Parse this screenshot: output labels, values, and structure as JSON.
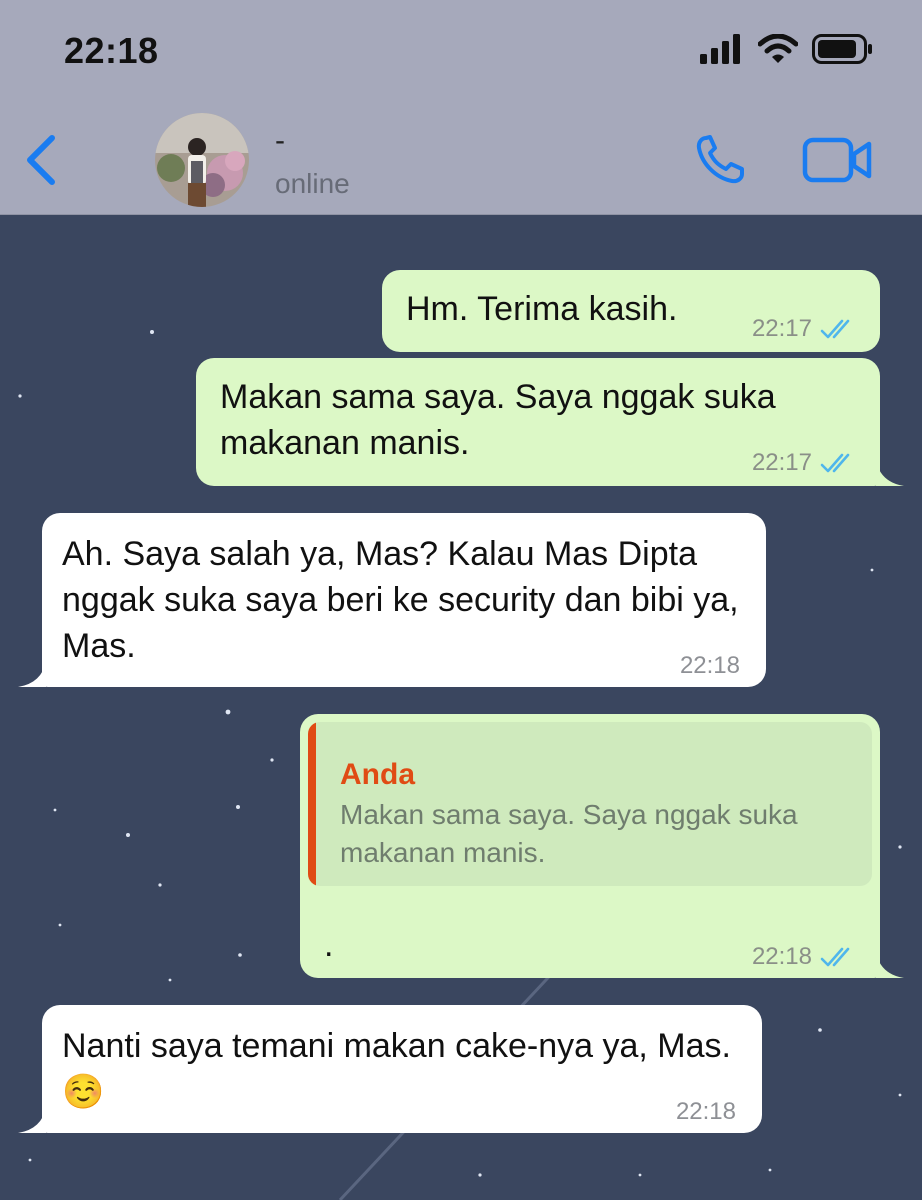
{
  "status_bar": {
    "time": "22:18"
  },
  "header": {
    "contact_name": "-",
    "contact_status": "online"
  },
  "messages": [
    {
      "direction": "out",
      "text": "Hm. Terima kasih.",
      "time": "22:17",
      "read": true
    },
    {
      "direction": "out",
      "text": "Makan sama saya. Saya nggak suka makanan manis.",
      "time": "22:17",
      "read": true
    },
    {
      "direction": "in",
      "text": "Ah. Saya salah ya, Mas? Kalau Mas Dipta nggak suka saya beri ke security dan bibi ya, Mas.",
      "time": "22:18"
    },
    {
      "direction": "out",
      "text": ".",
      "time": "22:18",
      "read": true,
      "reply_to": {
        "author": "Anda",
        "text": "Makan sama saya. Saya nggak suka makanan manis."
      }
    },
    {
      "direction": "in",
      "text": "Nanti saya temani makan cake-nya ya, Mas.☺️",
      "time": "22:18"
    }
  ],
  "colors": {
    "header_bg": "#a6a9bb",
    "accent_blue": "#1a7cf0",
    "outgoing_bubble": "#dcf8c6",
    "incoming_bubble": "#ffffff",
    "chat_background": "#3a465f",
    "reply_author": "#e04b14",
    "read_ticks": "#4fb6ec"
  },
  "icons": [
    "back-chevron-icon",
    "voice-call-icon",
    "video-call-icon",
    "signal-icon",
    "wifi-icon",
    "battery-icon",
    "read-receipt-icon"
  ]
}
